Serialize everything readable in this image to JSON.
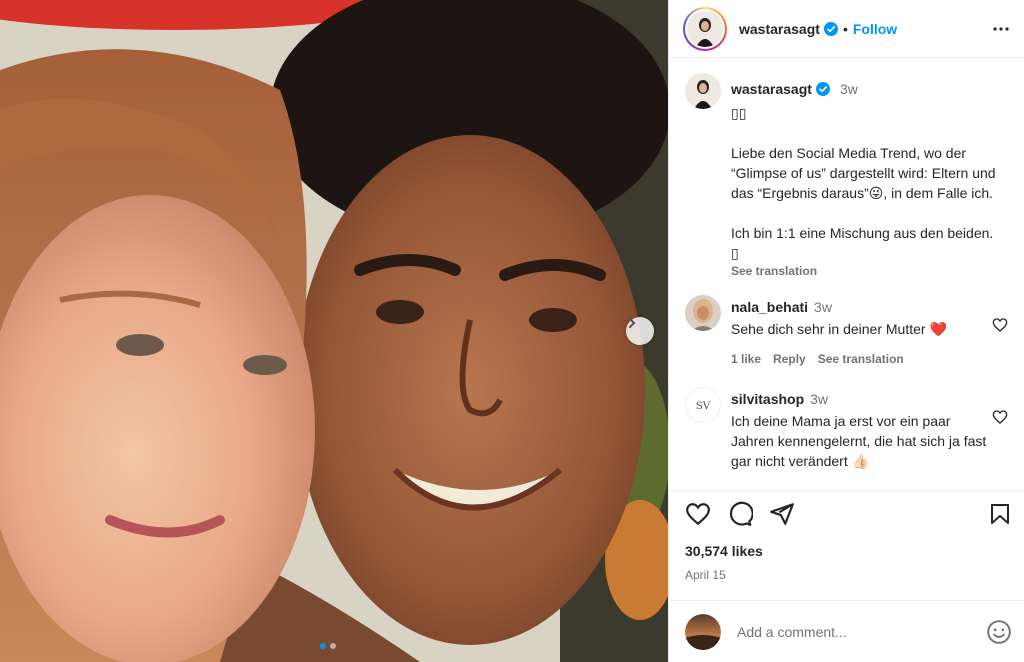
{
  "post": {
    "author": "wastarasagt",
    "follow_label": "Follow",
    "separator": "•"
  },
  "caption": {
    "author": "wastarasagt",
    "time": "3w",
    "text": "▯▯\n\nLiebe den Social Media Trend, wo der “Glimpse of us” dargestellt wird: Eltern und das “Ergebnis daraus”😜, in dem Falle ich.\n\nIch bin 1:1 eine Mischung aus den beiden. ▯",
    "see_translation": "See translation"
  },
  "comments": [
    {
      "user": "nala_behati",
      "time": "3w",
      "text": "Sehe dich sehr in deiner Mutter ❤️",
      "likes": "1 like",
      "reply": "Reply",
      "see_translation": "See translation"
    },
    {
      "user": "silvitashop",
      "time": "3w",
      "text": "Ich deine Mama ja erst vor ein paar Jahren kennengelernt, die hat sich ja fast gar nicht verändert 👍🏻"
    }
  ],
  "stats": {
    "likes": "30,574 likes",
    "date": "April 15"
  },
  "add_comment": {
    "placeholder": "Add a comment..."
  },
  "icons": {
    "more": "more-horizontal-icon",
    "like": "heart-icon",
    "comment": "comment-icon",
    "share": "paper-plane-icon",
    "save": "bookmark-icon",
    "emoji": "emoji-icon",
    "next": "chevron-right-icon",
    "verified": "verified-badge-icon"
  },
  "colors": {
    "accent": "#0095f6",
    "verified": "#0095f6",
    "heart_red": "#ed1c24",
    "muted": "#737373"
  },
  "carousel": {
    "slides": 2,
    "active_slide": 1
  }
}
